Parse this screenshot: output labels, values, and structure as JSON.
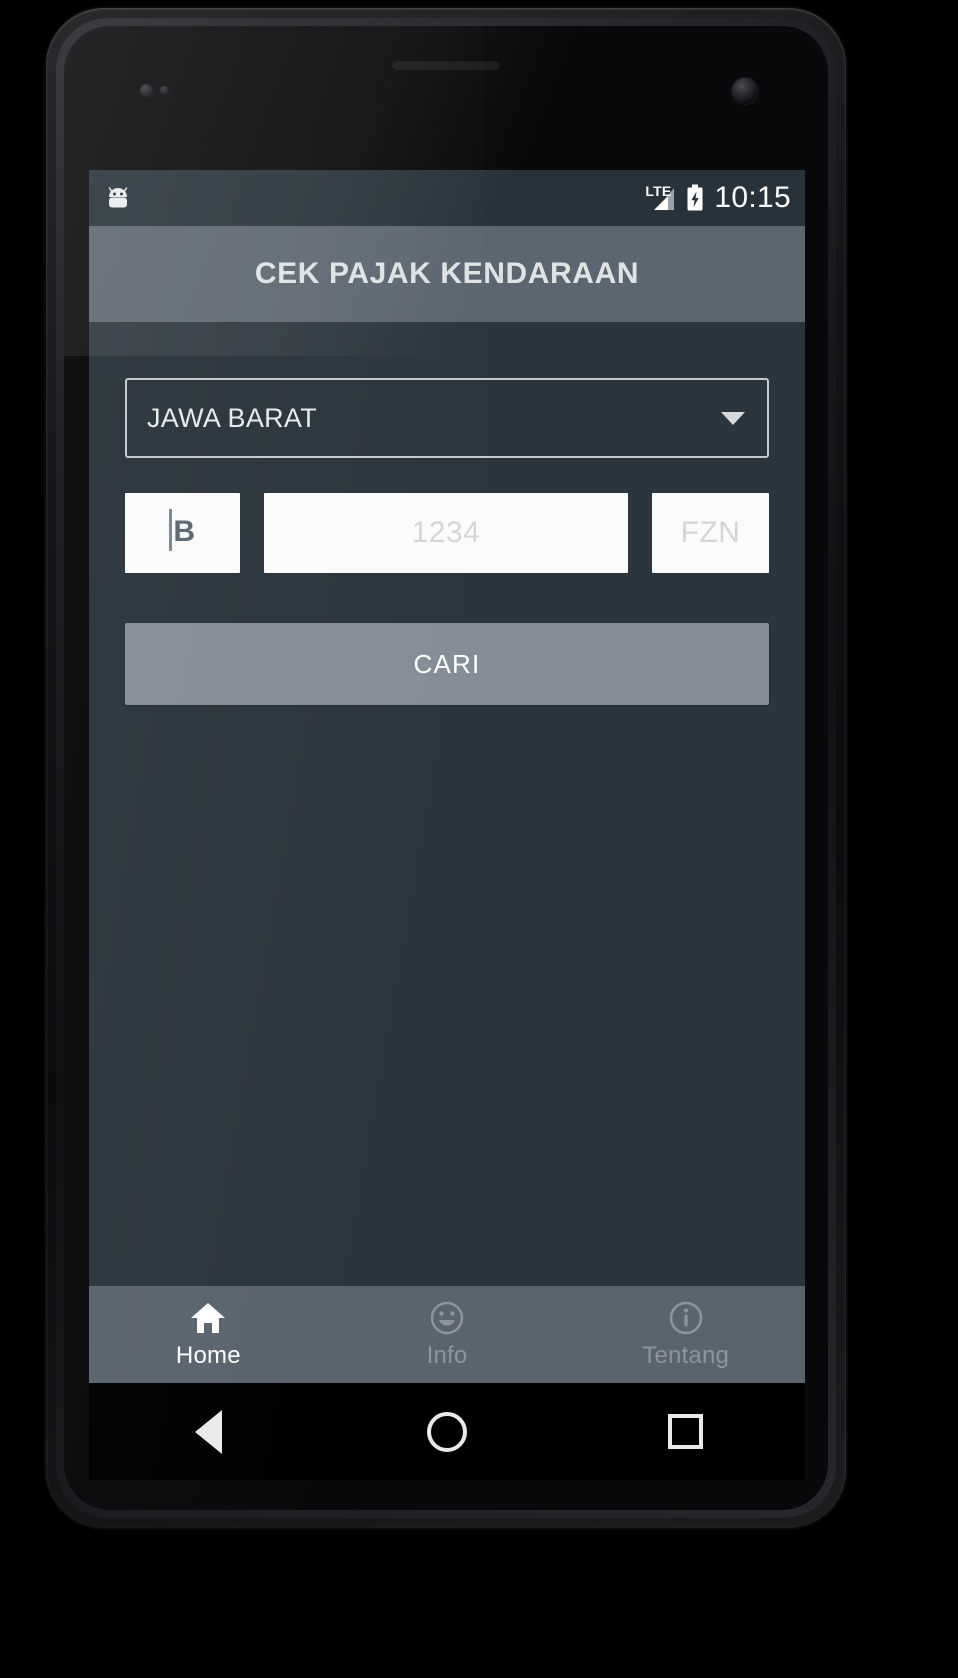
{
  "status_bar": {
    "notification_icon": "android-robot-icon",
    "network_label": "LTE",
    "signal_icon": "signal-bars-icon",
    "battery_icon": "battery-charging-icon",
    "time": "10:15"
  },
  "app_bar": {
    "title": "CEK PAJAK KENDARAAN"
  },
  "form": {
    "region_spinner": {
      "label": "region-spinner",
      "value": "JAWA BARAT",
      "caret_icon": "chevron-down-icon"
    },
    "plate": {
      "prefix": {
        "value": "B",
        "placeholder": "B"
      },
      "number": {
        "value": "",
        "placeholder": "1234"
      },
      "suffix": {
        "value": "",
        "placeholder": "FZN"
      }
    },
    "search_button": {
      "label": "CARI"
    }
  },
  "bottom_nav": {
    "items": [
      {
        "label": "Home",
        "icon": "home-icon",
        "active": true
      },
      {
        "label": "Info",
        "icon": "smiley-face-icon",
        "active": false
      },
      {
        "label": "Tentang",
        "icon": "info-circle-icon",
        "active": false
      }
    ]
  },
  "system_nav": {
    "back": "back-triangle-icon",
    "home": "home-circle-icon",
    "recents": "recents-square-icon"
  },
  "colors": {
    "app_bar": "#5c6670",
    "content_bg": "#2b353d",
    "status_bar": "#27323a",
    "button": "#858e98",
    "tab_bar": "#5a646e",
    "active_text": "#ffffff",
    "inactive_text": "#8d959c"
  }
}
